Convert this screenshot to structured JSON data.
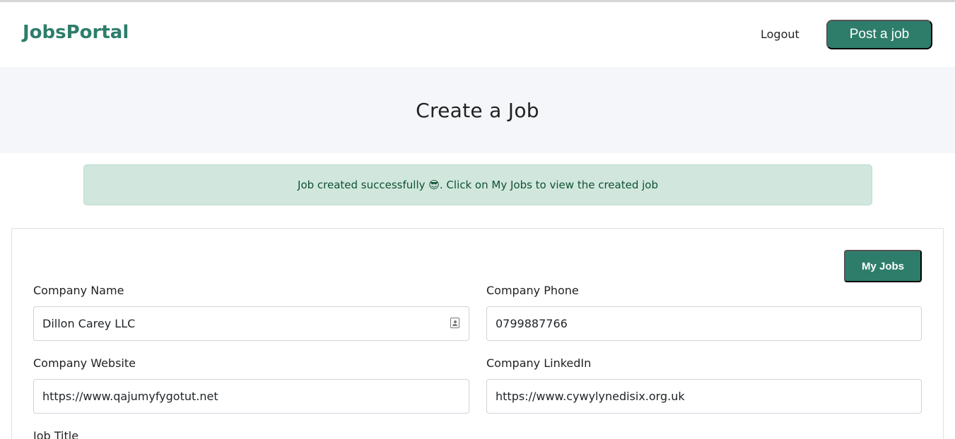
{
  "nav": {
    "brand": "JobsPortal",
    "logout_label": "Logout",
    "post_job_label": "Post a job"
  },
  "hero": {
    "title": "Create a Job"
  },
  "alert": {
    "message": "Job created successfully 😎. Click on My Jobs to view the created job"
  },
  "form": {
    "my_jobs_label": "My Jobs",
    "company_name": {
      "label": "Company Name",
      "value": "Dillon Carey LLC"
    },
    "company_phone": {
      "label": "Company Phone",
      "value": "0799887766"
    },
    "company_website": {
      "label": "Company Website",
      "value": "https://www.qajumyfygotut.net"
    },
    "company_linkedin": {
      "label": "Company LinkedIn",
      "value": "https://www.cywylynedisix.org.uk"
    },
    "job_title": {
      "label": "Job Title"
    }
  },
  "colors": {
    "brand": "#2e7d6b",
    "alert_bg": "#d1e7dd",
    "alert_text": "#0f5132",
    "hero_bg": "#f5f6f9"
  },
  "icons": {
    "company_name_autofill": "contact-card-icon"
  }
}
